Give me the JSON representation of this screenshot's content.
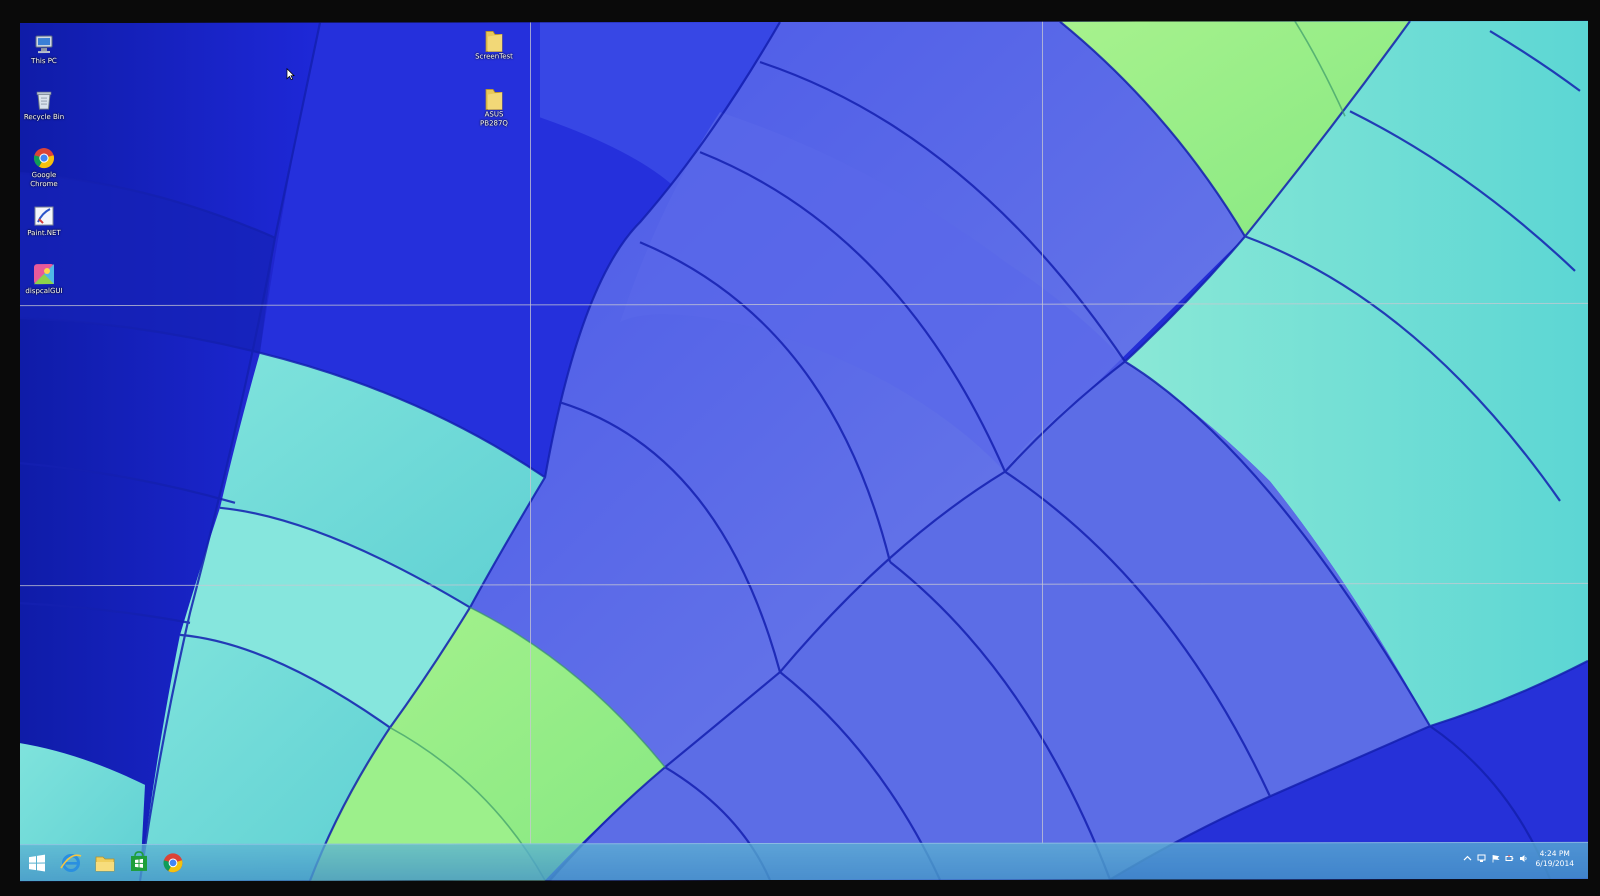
{
  "desktop": {
    "icons": [
      {
        "label": "This PC",
        "icon": "this-pc-icon"
      },
      {
        "label": "Recycle Bin",
        "icon": "recycle-bin-icon"
      },
      {
        "label": "Google Chrome",
        "icon": "chrome-icon"
      },
      {
        "label": "Paint.NET",
        "icon": "paint-net-icon"
      },
      {
        "label": "dispcalGUI",
        "icon": "dispcalgui-icon"
      },
      {
        "label": "ScreenTest",
        "icon": "folder-icon"
      },
      {
        "label": "ASUS PB287Q",
        "icon": "folder-icon"
      }
    ]
  },
  "taskbar": {
    "pinned": [
      {
        "name": "start-button",
        "icon": "windows-logo-icon"
      },
      {
        "name": "internet-explorer",
        "icon": "internet-explorer-icon"
      },
      {
        "name": "file-explorer",
        "icon": "file-explorer-icon"
      },
      {
        "name": "store",
        "icon": "windows-store-icon"
      },
      {
        "name": "chrome",
        "icon": "chrome-icon"
      }
    ],
    "tray": {
      "icons": [
        "show-hidden-icons-icon",
        "network-icon",
        "action-center-flag-icon",
        "power-icon",
        "volume-icon"
      ],
      "time": "4:24 PM",
      "date": "6/19/2014"
    }
  },
  "colors": {
    "deep_blue": "#1a1fd6",
    "periwinkle": "#5f6ee6",
    "turquoise": "#7ee3dc",
    "lime": "#9ff08a",
    "taskbar": "#5aa9cc"
  }
}
